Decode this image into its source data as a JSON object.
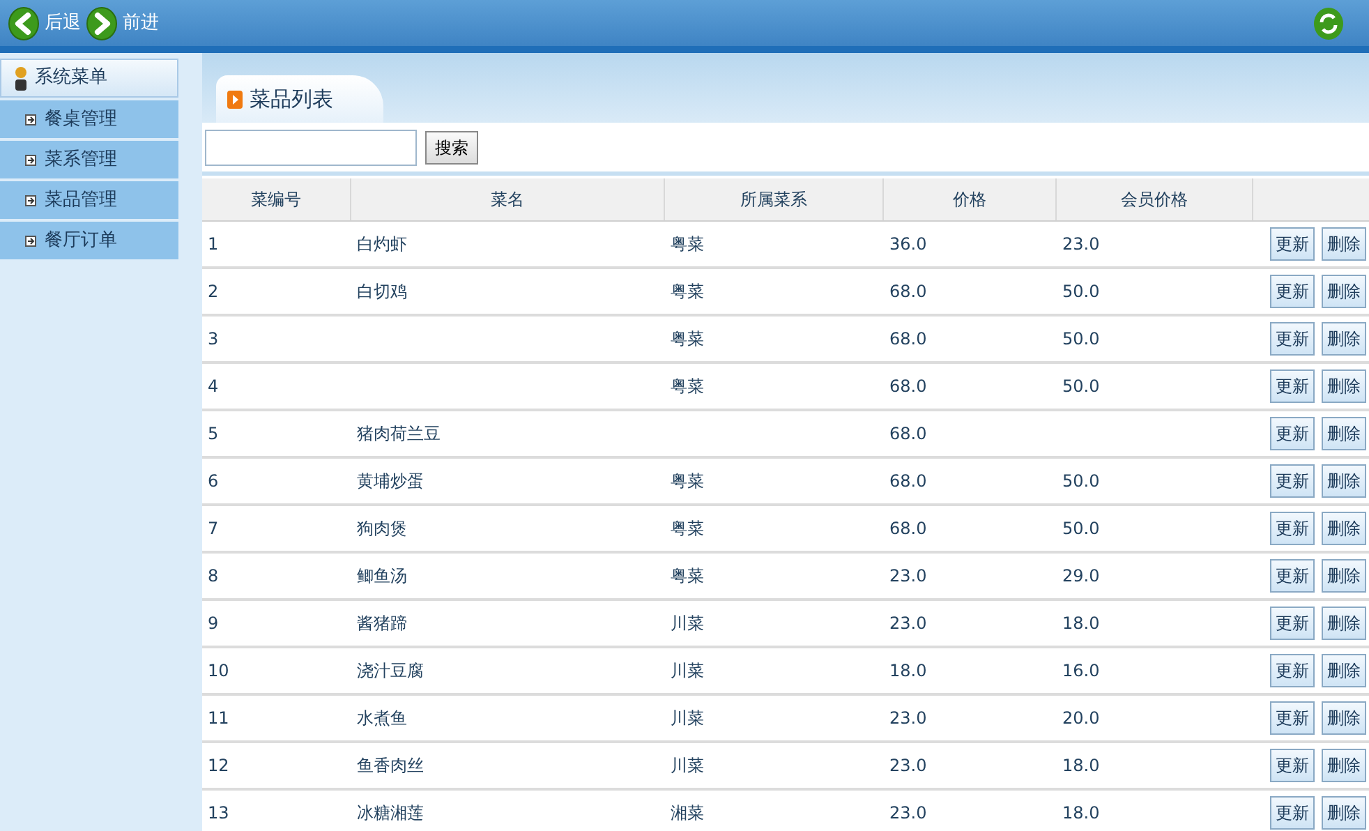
{
  "toolbar": {
    "back": "后退",
    "forward": "前进"
  },
  "sidebar": {
    "title": "系统菜单",
    "items": [
      {
        "label": "餐桌管理",
        "selected": false
      },
      {
        "label": "菜系管理",
        "selected": false
      },
      {
        "label": "菜品管理",
        "selected": false
      },
      {
        "label": "餐厅订单",
        "selected": false
      }
    ]
  },
  "tab": {
    "label": "菜品列表"
  },
  "search": {
    "button": "搜索"
  },
  "table": {
    "columns": [
      "菜编号",
      "菜名",
      "所属菜系",
      "价格",
      "会员价格"
    ],
    "rows": [
      {
        "id": "1",
        "name": "白灼虾",
        "cuisine": "粤菜",
        "price": "36.0",
        "vip_price": "23.0",
        "actions": [
          "更新",
          "删除"
        ]
      },
      {
        "id": "2",
        "name": "白切鸡",
        "cuisine": "粤菜",
        "price": "68.0",
        "vip_price": "50.0",
        "actions": [
          "更新",
          "删除"
        ]
      },
      {
        "id": "3",
        "cuisine": "粤菜",
        "price": "68.0",
        "vip_price": "50.0",
        "actions": [
          "更新",
          "删除"
        ]
      },
      {
        "id": "4",
        "cuisine": "粤菜",
        "price": "68.0",
        "vip_price": "50.0",
        "actions": [
          "更新",
          "删除"
        ]
      },
      {
        "id": "5",
        "name": "猪肉荷兰豆",
        "price": "68.0",
        "actions": [
          "更新",
          "删除"
        ]
      },
      {
        "id": "6",
        "name": "黄埔炒蛋",
        "cuisine": "粤菜",
        "price": "68.0",
        "vip_price": "50.0",
        "actions": [
          "更新",
          "删除"
        ]
      },
      {
        "id": "7",
        "name": "狗肉煲",
        "cuisine": "粤菜",
        "price": "68.0",
        "vip_price": "50.0",
        "actions": [
          "更新",
          "删除"
        ]
      },
      {
        "id": "8",
        "name": "鲫鱼汤",
        "cuisine": "粤菜",
        "price": "23.0",
        "vip_price": "29.0",
        "actions": [
          "更新",
          "删除"
        ]
      },
      {
        "id": "9",
        "name": "酱猪蹄",
        "cuisine": "川菜",
        "price": "23.0",
        "vip_price": "18.0",
        "actions": [
          "更新",
          "删除"
        ]
      },
      {
        "id": "10",
        "name": "浇汁豆腐",
        "cuisine": "川菜",
        "price": "18.0",
        "vip_price": "16.0",
        "actions": [
          "更新",
          "删除"
        ]
      },
      {
        "id": "11",
        "name": "水煮鱼",
        "cuisine": "川菜",
        "price": "23.0",
        "vip_price": "20.0",
        "actions": [
          "更新",
          "删除"
        ]
      },
      {
        "id": "12",
        "name": "鱼香肉丝",
        "cuisine": "川菜",
        "price": "23.0",
        "vip_price": "18.0",
        "actions": [
          "更新",
          "删除"
        ]
      },
      {
        "id": "13",
        "name": "冰糖湘莲",
        "cuisine": "湘菜",
        "price": "23.0",
        "vip_price": "18.0",
        "actions": [
          "更新",
          "删除"
        ]
      }
    ]
  }
}
